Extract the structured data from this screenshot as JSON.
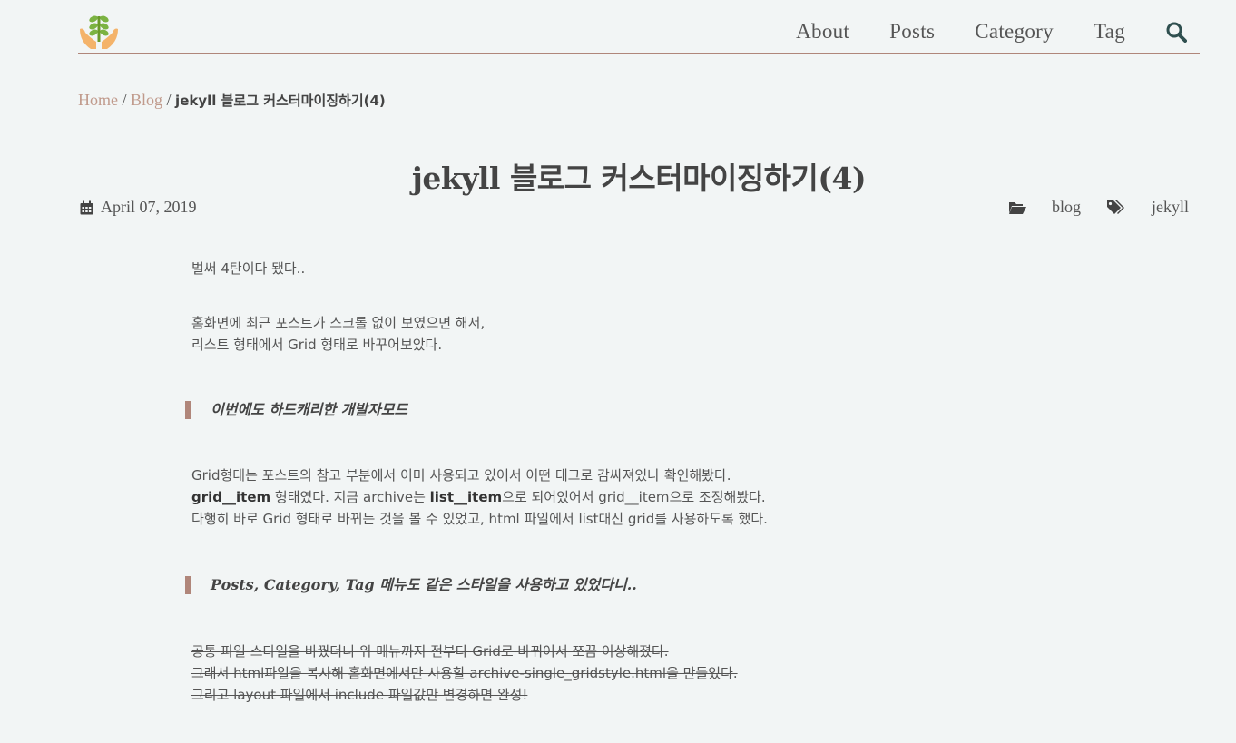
{
  "nav": {
    "items": [
      "About",
      "Posts",
      "Category",
      "Tag"
    ]
  },
  "breadcrumb": {
    "home": "Home",
    "sep": "/",
    "blog": "Blog",
    "current": "jekyll 블로그 커스터마이징하기(4)"
  },
  "post": {
    "title": "jekyll 블로그 커스터마이징하기(4)",
    "date": "April 07, 2019",
    "category": "blog",
    "tag": "jekyll",
    "p1": "벌써 4탄이다 됐다..",
    "p2_l1": "홈화면에 최근 포스트가 스크롤 없이 보였으면 해서,",
    "p2_l2": "리스트 형태에서 Grid 형태로 바꾸어보았다.",
    "quote1": "이번에도 하드캐리한 개발자모드",
    "p3_l1": "Grid형태는 포스트의 참고 부분에서 이미 사용되고 있어서 어떤 태그로 감싸져있나 확인해봤다.",
    "p3_l2_b1": "grid__item",
    "p3_l2_t1": " 형태였다. 지금 archive는 ",
    "p3_l2_b2": "list__item",
    "p3_l2_t2": "으로 되어있어서 grid__item으로 조정해봤다.",
    "p3_l3": "다행히 바로 Grid 형태로 바뀌는 것을 볼 수 있었고, html 파일에서 list대신 grid를 사용하도록 했다.",
    "quote2": "Posts, Category, Tag 메뉴도 같은 스타일을 사용하고 있었다니..",
    "p4_l1": "공통 파일 스타일을 바꿨더니 위 메뉴까지 전부다 Grid로 바뀌어서 쪼끔 이상해졌다.",
    "p4_l2": "그래서 html파일을 복사해 홈화면에서만 사용할 archive-single_gridstyle.html을 만들었다.",
    "p4_l3": "그리고 layout 파일에서 include 파일값만 변경하면 완성!"
  },
  "icons": {
    "logo": "plant-in-hands-logo",
    "search": "search-icon",
    "calendar": "calendar-icon",
    "folder": "folder-open-icon",
    "tags": "tags-icon"
  },
  "colors": {
    "accent": "#b0867a",
    "link": "#c09a8c",
    "background": "#f2f5f5"
  }
}
